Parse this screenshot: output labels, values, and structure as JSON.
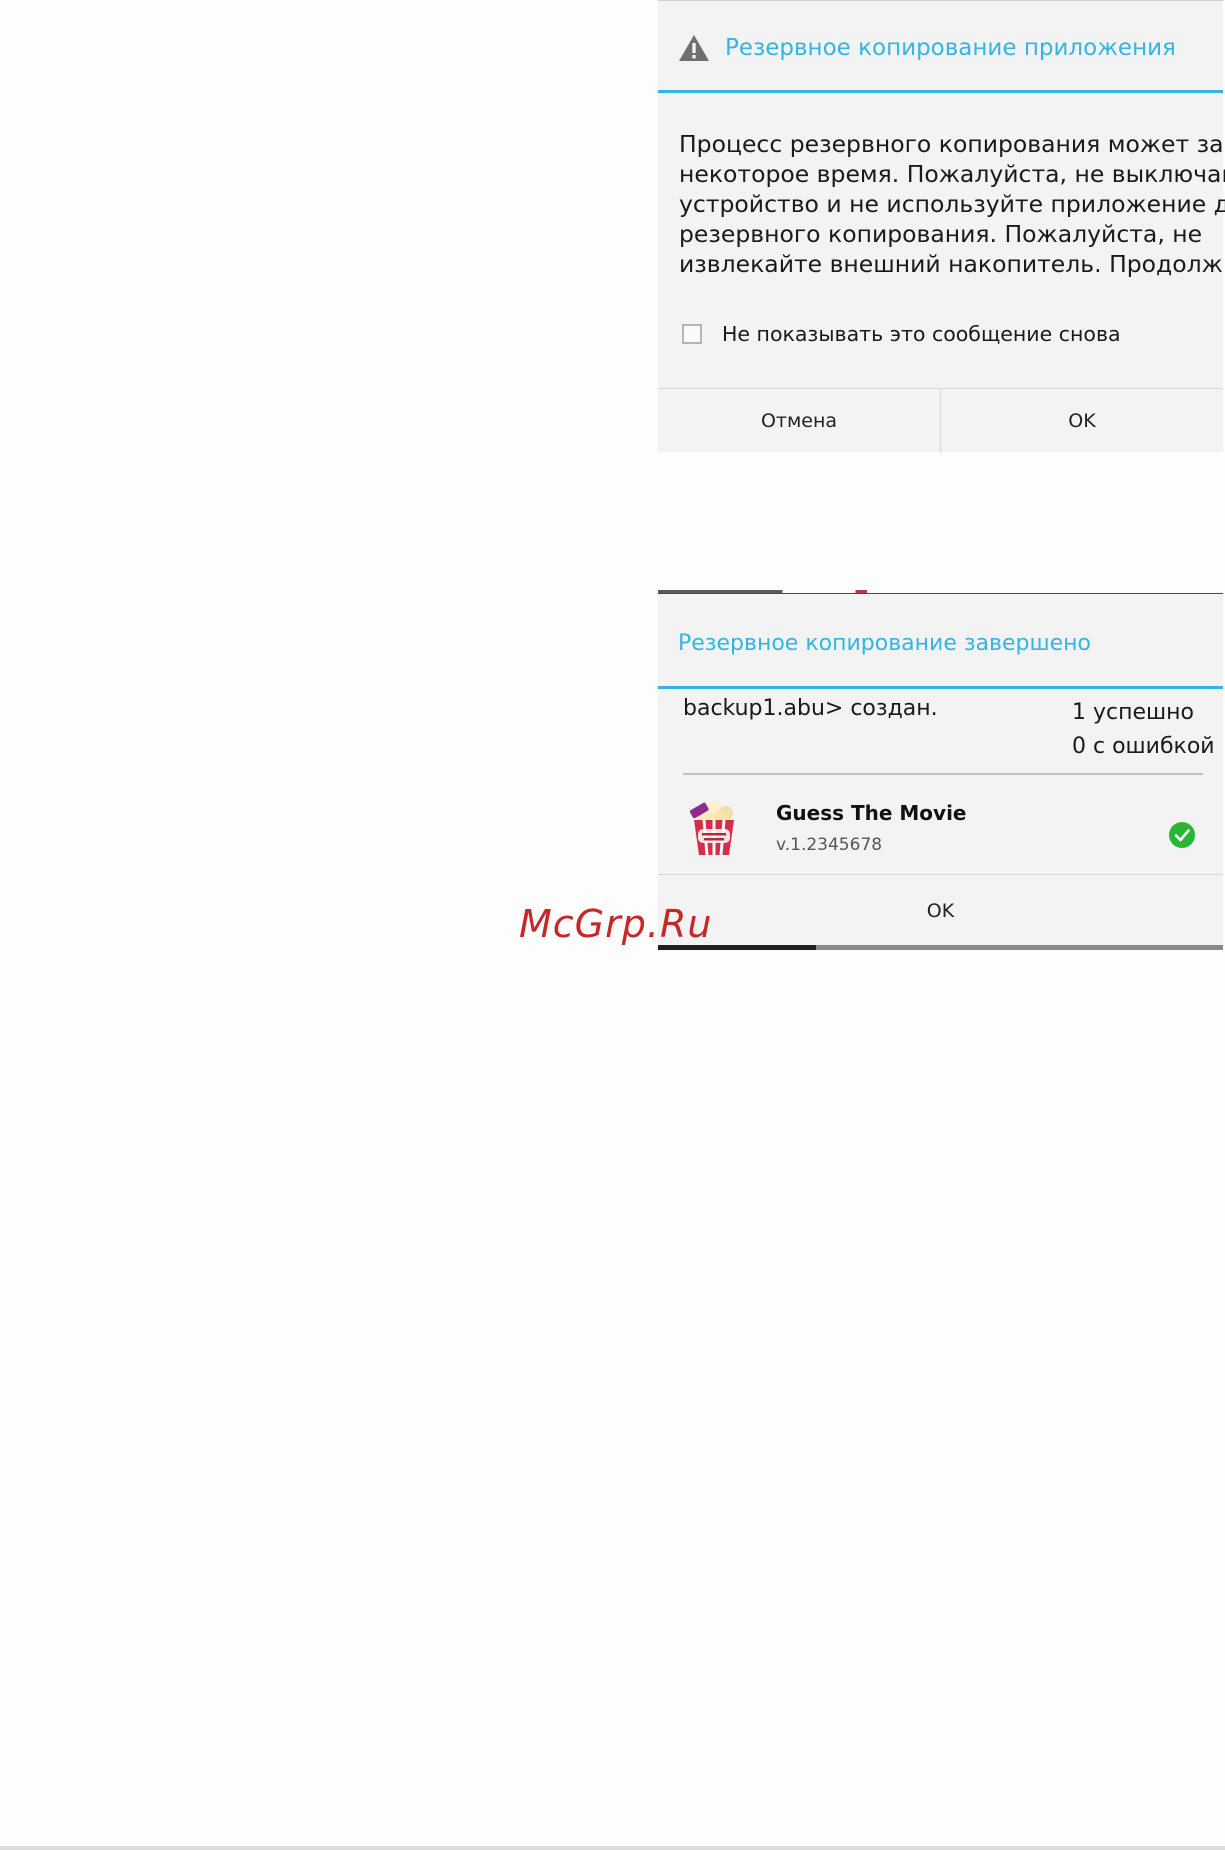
{
  "backup_dialog": {
    "title": "Резервное копирование приложения",
    "message_lines": [
      "Процесс резервного копирования может занять",
      "некоторое время. Пожалуйста, не выключайте",
      "устройство и не используйте приложение для",
      "резервного копирования. Пожалуйста, не",
      "извлекайте внешний накопитель. Продолжить?"
    ],
    "checkbox_label": "Не показывать это сообщение снова",
    "checkbox_checked": false,
    "cancel_label": "Отмена",
    "ok_label": "OK"
  },
  "complete_dialog": {
    "title": "Резервное копирование завершено",
    "file_created": "backup1.abu> создан.",
    "success_count": "1 успешно",
    "error_count": "0 с ошибкой",
    "app": {
      "name": "Guess The Movie",
      "version": "v.1.2345678",
      "status_icon": "check-icon"
    },
    "ok_label": "OK"
  },
  "watermark": "McGrp.Ru",
  "colors": {
    "accent": "#33b5e5",
    "success": "#2bb534",
    "watermark": "#c62828",
    "dialog_bg": "#f3f3f3"
  }
}
